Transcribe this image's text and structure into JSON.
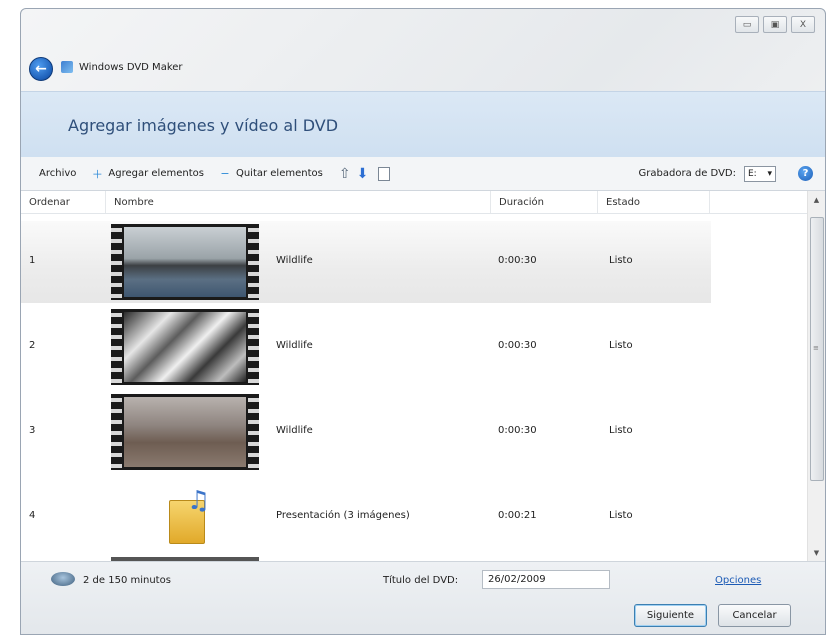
{
  "window": {
    "title": "Windows DVD Maker",
    "controls": {
      "minimize": "▭",
      "maximize": "▣",
      "close": "X"
    }
  },
  "header": {
    "title": "Agregar imágenes y vídeo al DVD"
  },
  "toolbar": {
    "file": "Archivo",
    "add": "Agregar elementos",
    "remove": "Quitar elementos",
    "recorder_label": "Grabadora de DVD:",
    "recorder_value": "E:",
    "help": "?"
  },
  "columns": {
    "order": "Ordenar",
    "name": "Nombre",
    "duration": "Duración",
    "state": "Estado"
  },
  "rows": [
    {
      "num": "1",
      "name": "Wildlife",
      "duration": "0:00:30",
      "state": "Listo"
    },
    {
      "num": "2",
      "name": "Wildlife",
      "duration": "0:00:30",
      "state": "Listo"
    },
    {
      "num": "3",
      "name": "Wildlife",
      "duration": "0:00:30",
      "state": "Listo"
    },
    {
      "num": "4",
      "name": "Presentación (3 imágenes)",
      "duration": "0:00:21",
      "state": "Listo"
    }
  ],
  "footer": {
    "minutes": "2 de 150 minutos",
    "title_label": "Título del DVD:",
    "title_value": "26/02/2009",
    "options": "Opciones",
    "next": "Siguiente",
    "cancel": "Cancelar"
  }
}
